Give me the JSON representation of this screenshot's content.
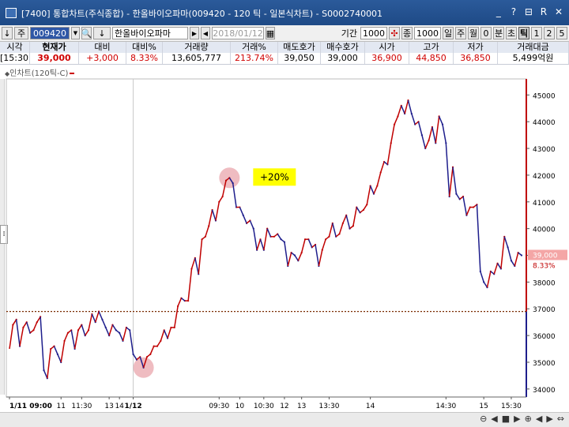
{
  "window": {
    "title": "[7400] 통합차트(주식종합) - 한올바이오파마(009420 - 120 틱 - 일본식차트) - S0002740001",
    "controls": [
      "_",
      "?",
      "⊟",
      "R",
      "✕"
    ]
  },
  "toolbar": {
    "left_icon": "↓",
    "tab_label": "주",
    "code": "009420",
    "sort_glyph": "↓",
    "stock_name": "한올바이오파마",
    "date": "2018/01/12",
    "period_label": "기간",
    "period_value": "1000",
    "count_label": "종",
    "count_value": "1000",
    "period_buttons": [
      {
        "label": "일",
        "active": false
      },
      {
        "label": "주",
        "active": false
      },
      {
        "label": "월",
        "active": false
      },
      {
        "label": "0",
        "active": false
      },
      {
        "label": "분",
        "active": false
      },
      {
        "label": "초",
        "active": false
      },
      {
        "label": "틱",
        "active": true
      },
      {
        "label": "1",
        "active": false
      },
      {
        "label": "2",
        "active": false
      },
      {
        "label": "5",
        "active": false
      }
    ]
  },
  "quote": {
    "headers": [
      "시각",
      "현재가",
      "대비",
      "대비%",
      "거래량",
      "거래%",
      "매도호가",
      "매수호가",
      "시가",
      "고가",
      "저가",
      "거래대금"
    ],
    "values": [
      "[15:30]",
      "39,000",
      "+3,000",
      "8.33%",
      "13,605,777",
      "213.74%",
      "39,050",
      "39,000",
      "36,900",
      "44,850",
      "36,850",
      "5,499억원"
    ]
  },
  "chart_label": "인차트(120틱-C)",
  "chart_data": {
    "type": "line",
    "series": [
      {
        "values": [
          35500,
          36400,
          36600,
          35600,
          36300,
          36500,
          36100,
          36200,
          36500,
          36700,
          34700,
          34400,
          35500,
          35600,
          35300,
          35000,
          35800,
          36100,
          36200,
          35500,
          36200,
          36400,
          36000,
          36200,
          36800,
          36500,
          36900,
          36600,
          36300,
          36000,
          36400,
          36200,
          36100,
          35800,
          36300,
          36200,
          35300,
          35100,
          35200,
          34800,
          35200,
          35300,
          35600,
          35600,
          35800,
          36200,
          35900,
          36300,
          36300,
          37100,
          37400,
          37300,
          37300,
          38500,
          38900,
          38300,
          39600,
          39700,
          40100,
          40700,
          40300,
          41000,
          41200,
          41800,
          41900,
          41700,
          40800,
          40800,
          40500,
          40200,
          40300,
          40000,
          39200,
          39600,
          39200,
          40000,
          39700,
          39700,
          39800,
          39600,
          39500,
          38600,
          39100,
          39000,
          38800,
          39100,
          39600,
          39600,
          39300,
          39400,
          38600,
          39200,
          39600,
          39700,
          40200,
          39700,
          39800,
          40200,
          40500,
          40000,
          40100,
          40800,
          40600,
          40700,
          40900,
          41600,
          41300,
          41600,
          42100,
          42500,
          42400,
          43200,
          43900,
          44200,
          44600,
          44300,
          44800,
          44300,
          43900,
          44000,
          43500,
          43000,
          43300,
          43800,
          43200,
          44200,
          43900,
          43200,
          41200,
          42300,
          41300,
          41100,
          41200,
          40500,
          40800,
          40800,
          40900,
          38400,
          38000,
          37800,
          38400,
          38300,
          38700,
          38500,
          39700,
          39300,
          38800,
          38600,
          39100,
          39000
        ],
        "color": "#c00000"
      }
    ],
    "ylim": [
      33700,
      45600
    ],
    "y_ticks": [
      34000,
      35000,
      36000,
      37000,
      38000,
      39000,
      40000,
      41000,
      42000,
      43000,
      44000,
      45000
    ],
    "x_tick_labels": [
      {
        "i": 0,
        "label": "1/11 09:00",
        "bold": true
      },
      {
        "i": 15,
        "label": "11",
        "bold": false
      },
      {
        "i": 21,
        "label": "11:30",
        "bold": false
      },
      {
        "i": 29,
        "label": "13",
        "bold": false
      },
      {
        "i": 32,
        "label": "14",
        "bold": false
      },
      {
        "i": 36,
        "label": "1/12",
        "bold": true
      },
      {
        "i": 61,
        "label": "09:30",
        "bold": false
      },
      {
        "i": 67,
        "label": "10",
        "bold": false
      },
      {
        "i": 74,
        "label": "10:30",
        "bold": false
      },
      {
        "i": 80,
        "label": "12",
        "bold": false
      },
      {
        "i": 85,
        "label": "13",
        "bold": false
      },
      {
        "i": 93,
        "label": "13:30",
        "bold": false
      },
      {
        "i": 105,
        "label": "14",
        "bold": false
      },
      {
        "i": 127,
        "label": "14:30",
        "bold": false
      },
      {
        "i": 138,
        "label": "15",
        "bold": false
      },
      {
        "i": 146,
        "label": "15:30",
        "bold": false
      }
    ],
    "reference_line": 36900,
    "current_price_label": "39,000",
    "current_change_label": "8.33%",
    "annotation": "+20%",
    "highlight_low_index": 39,
    "highlight_high_index": 64,
    "day_split_index": 36,
    "colors": {
      "up": "#c00000",
      "down": "#1e1e8c",
      "grid": "#d9d9d9",
      "reference": "#7a2a00",
      "annotation_bg": "#ffff00",
      "highlight": "#e8a0a6"
    }
  }
}
